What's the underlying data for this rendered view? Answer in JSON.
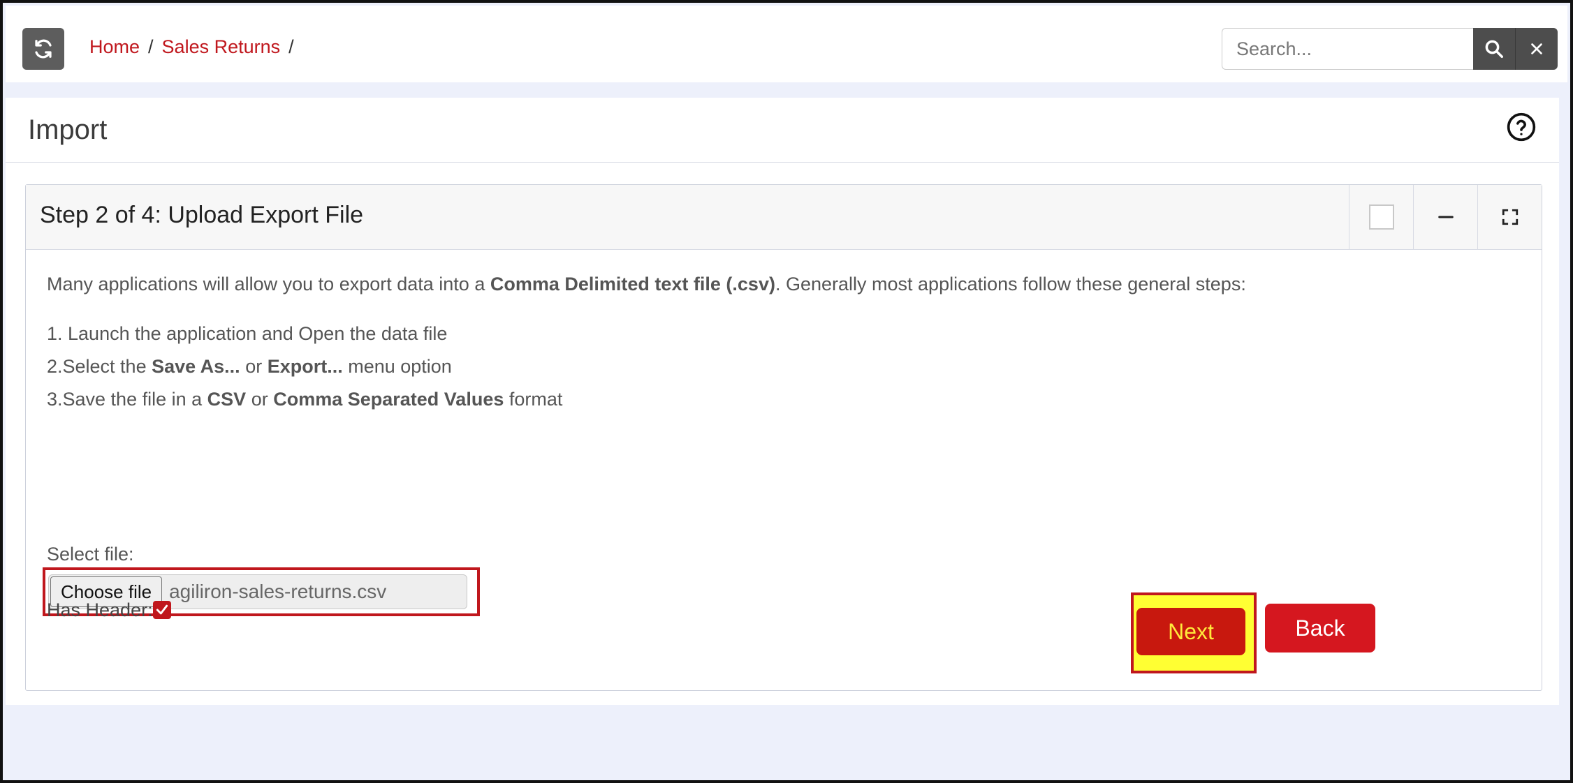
{
  "breadcrumb": {
    "home": "Home",
    "sales_returns": "Sales Returns",
    "separator": "/"
  },
  "search": {
    "placeholder": "Search..."
  },
  "page": {
    "title": "Import"
  },
  "card": {
    "title": "Step 2 of 4: Upload Export File",
    "intro_before": "Many applications will allow you to export data into a ",
    "intro_bold": "Comma Delimited text file (.csv)",
    "intro_after": ". Generally most applications follow these general steps:",
    "step1": "1. Launch the application and Open the data file",
    "step2_prefix": "2.Select the ",
    "step2_bold1": "Save As...",
    "step2_mid": " or ",
    "step2_bold2": "Export...",
    "step2_suffix": " menu option",
    "step3_prefix": "3.Save the file in a ",
    "step3_bold1": "CSV",
    "step3_mid": " or ",
    "step3_bold2": "Comma Separated Values",
    "step3_suffix": " format",
    "select_label": "Select file:",
    "choose_button": "Choose file",
    "file_name": "agiliron-sales-returns.csv",
    "has_header_label": "Has Header:",
    "has_header_checked": true,
    "next_button": "Next",
    "back_button": "Back"
  },
  "icons": {
    "refresh": "refresh-icon",
    "search": "search-icon",
    "clear": "close-icon",
    "help": "help-icon",
    "minimize": "minimize-icon",
    "fullscreen": "fullscreen-icon"
  },
  "colors": {
    "accent_red": "#c0171d",
    "highlight_yellow": "#ffff33",
    "dark_button": "#4d4d4d",
    "background": "#edf0fb"
  }
}
